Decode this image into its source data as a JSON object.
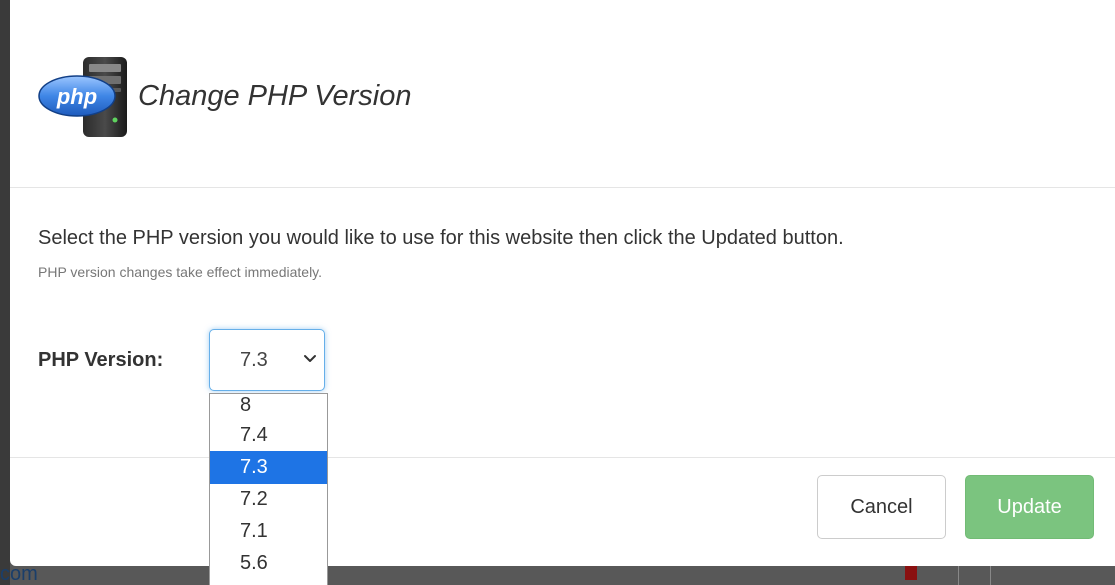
{
  "background": {
    "partial_text": "com"
  },
  "dialog": {
    "title": "Change PHP Version",
    "logo_text": "php",
    "instructions": "Select the PHP version you would like to use for this website then click the Updated button.",
    "help_text": "PHP version changes take effect immediately.",
    "version_label": "PHP Version:",
    "selected_version": "7.3",
    "version_options": [
      "8",
      "7.4",
      "7.3",
      "7.2",
      "7.1",
      "5.6"
    ],
    "buttons": {
      "cancel_label": "Cancel",
      "update_label": "Update"
    }
  },
  "colors": {
    "update_button": "#7bc47f",
    "selection_highlight": "#1e74e5",
    "focus_border": "#66afe9"
  }
}
